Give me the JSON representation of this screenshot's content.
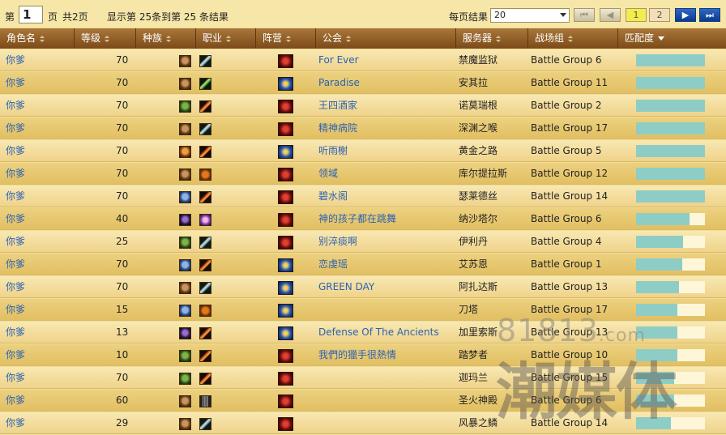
{
  "pager": {
    "prefix": "第",
    "page": "1",
    "page_suffix": "页",
    "total_pages": "共2页",
    "summary": "显示第 25条到第 25 条结果",
    "per_page_label": "每页结果",
    "per_page_value": "20",
    "buttons": {
      "page1": "1",
      "page2": "2"
    }
  },
  "columns": [
    "角色名",
    "等级",
    "种族",
    "职业",
    "阵营",
    "公会",
    "服务器",
    "战场组",
    "匹配度"
  ],
  "rows": [
    {
      "name": "你爹",
      "level": "70",
      "race": "tauren",
      "cls": "warrior",
      "faction": "horde",
      "guild": "For Ever",
      "server": "禁魔监狱",
      "group": "Battle Group 6",
      "match": 100
    },
    {
      "name": "你爹",
      "level": "70",
      "race": "dwarf",
      "cls": "hunter",
      "faction": "alliance",
      "guild": "Paradise",
      "server": "安其拉",
      "group": "Battle Group 11",
      "match": 100
    },
    {
      "name": "你爹",
      "level": "70",
      "race": "orc",
      "cls": "rogue",
      "faction": "horde",
      "guild": "王四酒家",
      "server": "诺莫瑞根",
      "group": "Battle Group 2",
      "match": 100
    },
    {
      "name": "你爹",
      "level": "70",
      "race": "tauren",
      "cls": "warrior",
      "faction": "horde",
      "guild": "精神病院",
      "server": "深渊之喉",
      "group": "Battle Group 17",
      "match": 100
    },
    {
      "name": "你爹",
      "level": "70",
      "race": "human",
      "cls": "rogue",
      "faction": "alliance",
      "guild": "听雨榭",
      "server": "黄金之路",
      "group": "Battle Group 5",
      "match": 100
    },
    {
      "name": "你爹",
      "level": "70",
      "race": "tauren",
      "cls": "druid",
      "faction": "horde",
      "guild": "领域",
      "server": "库尔提拉斯",
      "group": "Battle Group 12",
      "match": 100
    },
    {
      "name": "你爹",
      "level": "70",
      "race": "gnome",
      "cls": "rogue",
      "faction": "horde",
      "guild": "碧水阁",
      "server": "瑟莱德丝",
      "group": "Battle Group 14",
      "match": 100
    },
    {
      "name": "你爹",
      "level": "40",
      "race": "undead",
      "cls": "priest",
      "faction": "horde",
      "guild": "神的孩子都在跳舞",
      "server": "纳沙塔尔",
      "group": "Battle Group 6",
      "match": 78
    },
    {
      "name": "你爹",
      "level": "25",
      "race": "orc",
      "cls": "warrior",
      "faction": "horde",
      "guild": "别淬痰啊",
      "server": "伊利丹",
      "group": "Battle Group 4",
      "match": 68
    },
    {
      "name": "你爹",
      "level": "70",
      "race": "draenei",
      "cls": "rogue",
      "faction": "alliance",
      "guild": "恋虔瑶",
      "server": "艾苏恩",
      "group": "Battle Group 1",
      "match": 67
    },
    {
      "name": "你爹",
      "level": "70",
      "race": "tauren",
      "cls": "warrior",
      "faction": "alliance",
      "guild": "GREEN DAY",
      "server": "阿扎达斯",
      "group": "Battle Group 13",
      "match": 62
    },
    {
      "name": "你爹",
      "level": "15",
      "race": "draenei",
      "cls": "druid",
      "faction": "alliance",
      "guild": "",
      "server": "刀塔",
      "group": "Battle Group 17",
      "match": 60
    },
    {
      "name": "你爹",
      "level": "13",
      "race": "blood",
      "cls": "rogue",
      "faction": "alliance",
      "guild": "Defense Of The Ancients",
      "server": "加里索斯",
      "group": "Battle Group 13",
      "match": 60
    },
    {
      "name": "你爹",
      "level": "10",
      "race": "orc",
      "cls": "rogue",
      "faction": "horde",
      "guild": "我們的獵手很熱情",
      "server": "踏梦者",
      "group": "Battle Group 10",
      "match": 60
    },
    {
      "name": "你爹",
      "level": "70",
      "race": "orc",
      "cls": "rogue",
      "faction": "horde",
      "guild": "",
      "server": "迦玛兰",
      "group": "Battle Group 15",
      "match": 55
    },
    {
      "name": "你爹",
      "level": "60",
      "race": "tauren",
      "cls": "claw",
      "faction": "horde",
      "guild": "",
      "server": "圣火神殿",
      "group": "Battle Group 6",
      "match": 55
    },
    {
      "name": "你爹",
      "level": "29",
      "race": "tauren",
      "cls": "warrior",
      "faction": "horde",
      "guild": "",
      "server": "风暴之鳞",
      "group": "Battle Group 14",
      "match": 50
    }
  ],
  "watermark": {
    "domain": "81813",
    "tld": ".com",
    "brand": "潮媒体"
  }
}
